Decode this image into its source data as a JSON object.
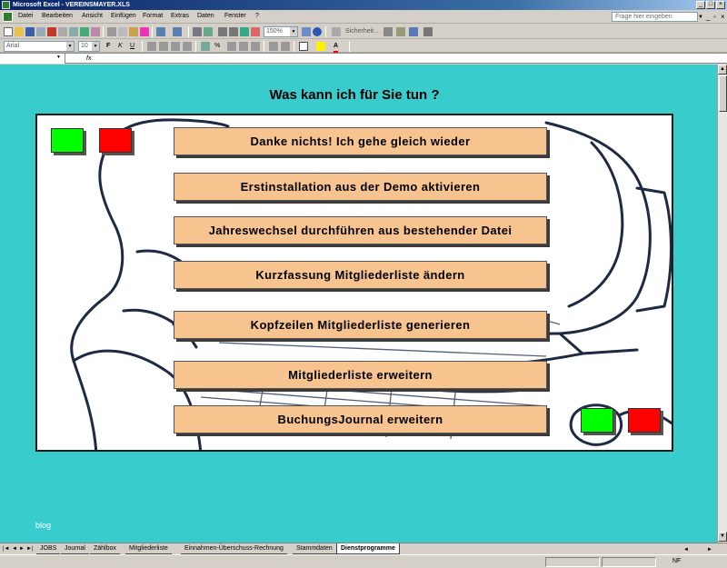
{
  "window": {
    "title": "Microsoft Excel - VEREINSMAYER.XLS"
  },
  "menu": {
    "items": [
      "Datei",
      "Bearbeiten",
      "Ansicht",
      "Einfügen",
      "Format",
      "Extras",
      "Daten",
      "Fenster",
      "?"
    ],
    "help_placeholder": "Frage hier eingeben"
  },
  "toolbar": {
    "zoom": "150%",
    "security_label": "Sicherheit...",
    "font_name": "Arial",
    "font_size": "10"
  },
  "formula": {
    "fx": "fx"
  },
  "sheet": {
    "headline": "Was kann ich für Sie tun ?",
    "actions": [
      "Danke nichts! Ich gehe gleich wieder",
      "Erstinstallation aus der Demo aktivieren",
      "Jahreswechsel durchführen aus bestehender Datei",
      "Kurzfassung Mitgliederliste ändern",
      "Kopfzeilen Mitgliederliste generieren",
      "Mitgliederliste erweitern",
      "BuchungsJournal erweitern"
    ],
    "footer_text": "blog",
    "colors": {
      "background": "#39cccc",
      "button": "#f7c490",
      "green": "#00ff00",
      "red": "#ff0000"
    }
  },
  "tabs": {
    "items": [
      "JOBS",
      "Journal",
      "Zählbox",
      "Mitgliederliste",
      "Einnahmen-Überschuss-Rechnung",
      "Stammdaten",
      "Dienstprogramme"
    ],
    "active": "Dienstprogramme"
  },
  "status": {
    "indicator": "NF"
  }
}
